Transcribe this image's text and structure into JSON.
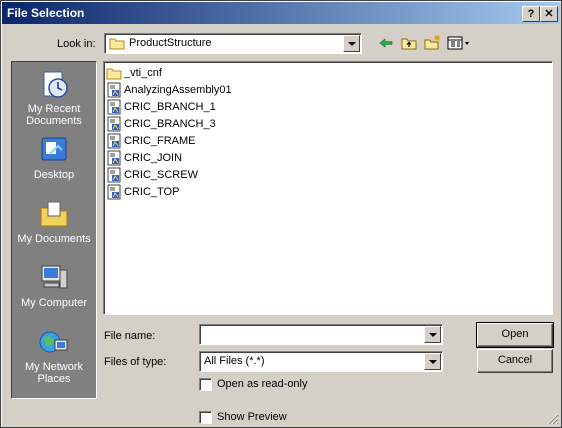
{
  "window": {
    "title": "File Selection",
    "help_glyph": "?",
    "close_glyph": "✕"
  },
  "lookin": {
    "label": "Look in:",
    "value": "ProductStructure"
  },
  "toolbar": {
    "icons": [
      "back-icon",
      "up-folder-icon",
      "new-folder-icon",
      "view-menu-icon"
    ]
  },
  "places": [
    {
      "label": "My Recent Documents",
      "icon": "recent-documents-icon"
    },
    {
      "label": "Desktop",
      "icon": "desktop-icon"
    },
    {
      "label": "My Documents",
      "icon": "my-documents-icon"
    },
    {
      "label": "My Computer",
      "icon": "my-computer-icon"
    },
    {
      "label": "My Network Places",
      "icon": "network-places-icon"
    }
  ],
  "files": [
    {
      "name": "_vti_cnf",
      "type": "folder"
    },
    {
      "name": "AnalyzingAssembly01",
      "type": "product"
    },
    {
      "name": "CRIC_BRANCH_1",
      "type": "product"
    },
    {
      "name": "CRIC_BRANCH_3",
      "type": "product"
    },
    {
      "name": "CRIC_FRAME",
      "type": "product"
    },
    {
      "name": "CRIC_JOIN",
      "type": "product"
    },
    {
      "name": "CRIC_SCREW",
      "type": "product"
    },
    {
      "name": "CRIC_TOP",
      "type": "product"
    }
  ],
  "filename": {
    "label": "File name:",
    "value": ""
  },
  "filetype": {
    "label": "Files of type:",
    "value": "All Files (*.*)"
  },
  "buttons": {
    "open": "Open",
    "cancel": "Cancel"
  },
  "options": {
    "read_only": "Open as read-only",
    "preview": "Show Preview"
  },
  "colors": {
    "title_start": "#0a246a",
    "title_end": "#a6caf0",
    "places_bg": "#808080",
    "face": "#d4d0c8"
  }
}
